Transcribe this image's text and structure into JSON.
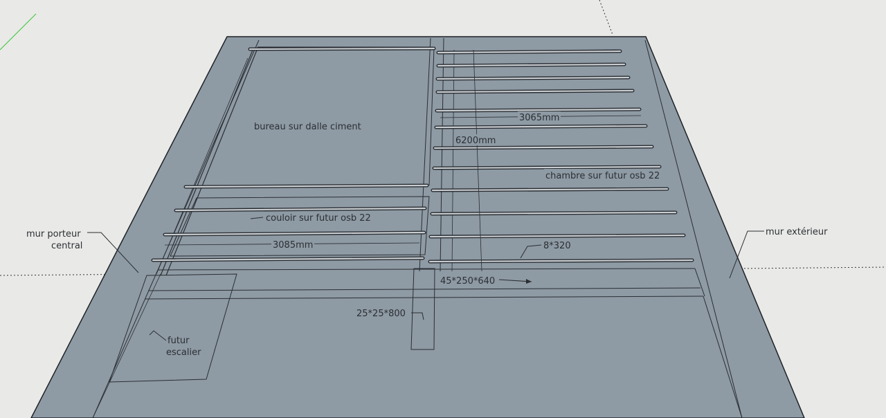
{
  "colors": {
    "background": "#e9e9e7",
    "slab": "#8e9aa4",
    "slab_edge": "#1e2226",
    "floor_front": "#8a97a1",
    "joist_fill": "#c9ced2",
    "line": "#2a2e32",
    "axis_green": "#37c837"
  },
  "labels": {
    "bureau": "bureau sur dalle ciment",
    "chambre": "chambre sur futur osb 22",
    "couloir": "couloir sur futur osb 22",
    "dim_3065": "3065mm",
    "dim_6200": "6200mm",
    "dim_3085": "3085mm",
    "dim_8x320": "8*320",
    "dim_45x250x640": "45*250*640",
    "dim_25x25x800": "25*25*800",
    "mur_porteur_line1": "mur porteur",
    "mur_porteur_line2": "central",
    "mur_exterieur": "mur extérieur",
    "escalier_line1": "futur",
    "escalier_line2": "escalier"
  }
}
